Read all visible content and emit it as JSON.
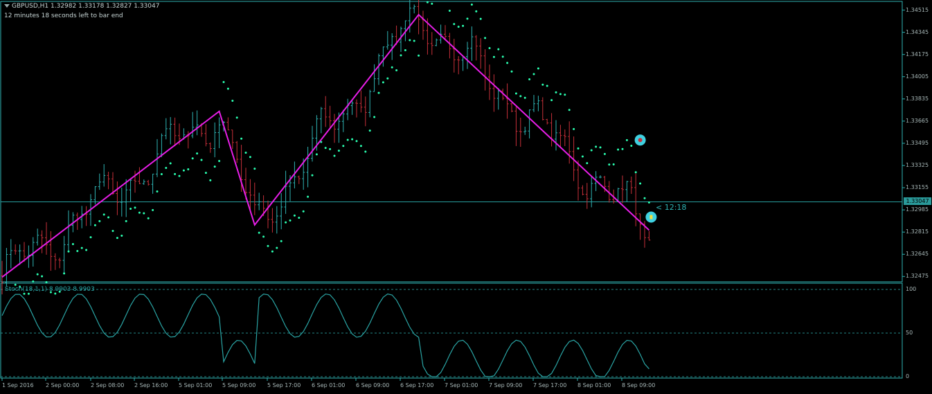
{
  "header": {
    "symbol_line": "GBPUSD,H1  1.32982 1.33178 1.32827 1.33047",
    "timer_line": "12 minutes 18 seconds left to bar end"
  },
  "indicator": {
    "label": "Stoch(18,1,1) 8.9903 8.9903"
  },
  "price_axis": {
    "ticks": [
      "1.34515",
      "1.34345",
      "1.34175",
      "1.34005",
      "1.33835",
      "1.33665",
      "1.33495",
      "1.33325",
      "1.33155",
      "1.32985",
      "1.32815",
      "1.32645",
      "1.32475"
    ],
    "current_price": "1.33047",
    "timer_label": "< 12:18"
  },
  "stoch_axis": {
    "ticks": [
      "100",
      "50",
      "0"
    ]
  },
  "time_axis": {
    "labels": [
      "1 Sep 2016",
      "2 Sep 00:00",
      "2 Sep 08:00",
      "2 Sep 16:00",
      "5 Sep 01:00",
      "5 Sep 09:00",
      "5 Sep 17:00",
      "6 Sep 01:00",
      "6 Sep 09:00",
      "6 Sep 17:00",
      "7 Sep 01:00",
      "7 Sep 09:00",
      "7 Sep 17:00",
      "8 Sep 01:00",
      "8 Sep 09:00"
    ]
  },
  "colors": {
    "background": "#000000",
    "axis": "#2fb5b5",
    "bull": "#2fb5b5",
    "bear": "#c8303a",
    "sar": "#2affb0",
    "zigzag": "#e81ee8",
    "stoch": "#2aa5a5"
  },
  "chart_data": {
    "type": "candlestick",
    "symbol": "GBPUSD",
    "timeframe": "H1",
    "ylim": [
      1.3245,
      1.3455
    ],
    "zigzag": [
      1.3247,
      1.3374,
      1.3287,
      1.3448,
      1.3283
    ],
    "stoch_ylim": [
      0,
      100
    ],
    "stoch_levels": [
      100,
      50,
      0
    ],
    "last_price": 1.33047,
    "last_stoch": 8.9903
  }
}
